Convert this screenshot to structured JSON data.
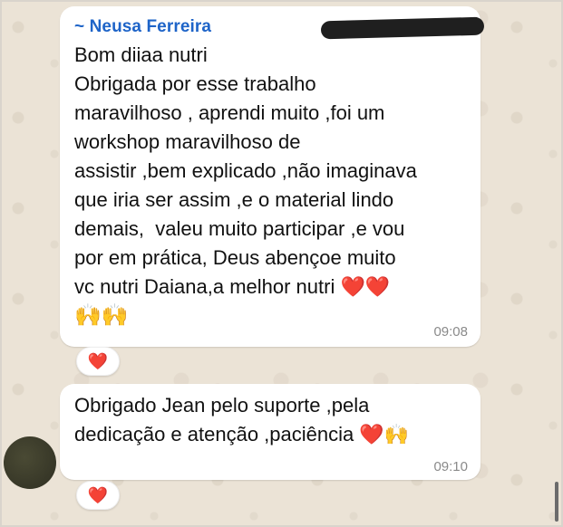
{
  "messages": [
    {
      "sender": "~ Neusa Ferreira",
      "text": "Bom diiaa nutri\nObrigada por esse trabalho\nmaravilhoso , aprendi muito ,foi um\nworkshop maravilhoso de\nassistir ,bem explicado ,não imaginava\nque iria ser assim ,e o material lindo\ndemais,  valeu muito participar ,e vou\npor em prática, Deus abençoe muito\nvc nutri Daiana,a melhor nutri ❤️❤️",
      "emoji_line": "🙌🙌",
      "time": "09:08",
      "reaction": "❤️"
    },
    {
      "text": "Obrigado Jean pelo suporte ,pela\ndedicação e atenção ,paciência ❤️🙌",
      "time": "09:10",
      "reaction": "❤️"
    }
  ]
}
